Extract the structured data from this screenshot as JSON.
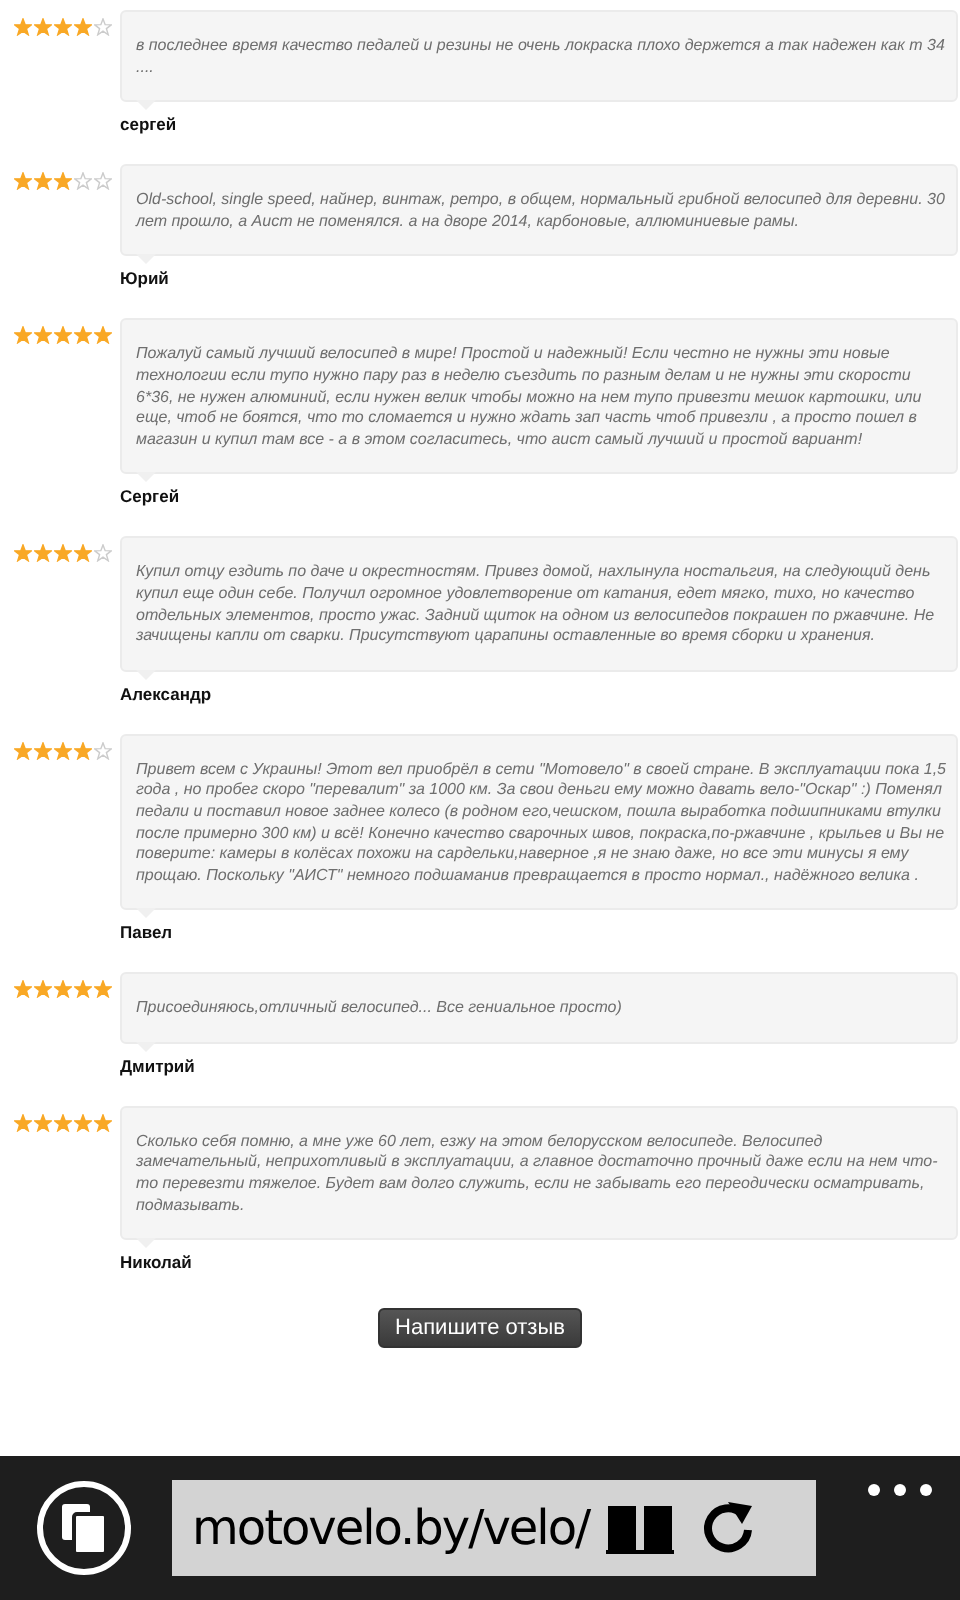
{
  "reviews": [
    {
      "stars": 4,
      "text": "в последнее время качество педалей и резины не очень локраска плохо держется а так надежен как т 34 ....",
      "author": "сергей"
    },
    {
      "stars": 3,
      "text": "Old-school, single speed, найнер, винтаж, ретро, в общем, нормальный грибной велосипед для деревни. 30 лет прошло, а Аист не поменялся. а на дворе 2014, карбоновые, аллюминиевые рамы.",
      "author": "Юрий"
    },
    {
      "stars": 5,
      "text": "Пожалуй самый лучший велосипед в мире! Простой и надежный! Если честно не нужны эти новые технологии если тупо нужно пару раз в неделю съездить по разным делам и не нужны эти скорости 6*36, не нужен алюминий, если нужен велик чтобы можно на нем тупо привезти мешок картошки, или еще, чтоб не боятся, что то сломается и нужно ждать зап часть чтоб привезли , а просто пошел в магазин и купил там все - а в этом согласитесь, что аист самый лучший и простой вариант!",
      "author": "Сергей"
    },
    {
      "stars": 4,
      "text": "Купил отцу ездить по даче и окрестностям. Привез домой, нахлынула ностальгия, на следующий день купил еще один себе. Получил огромное удовлетворение от катания, едет мягко, тихо, но качество отдельных элементов, просто ужас. Задний щиток на одном из велосипедов покрашен по ржавчине. Не зачищены капли от сварки. Присутствуют царапины оставленные во время сборки и хранения.",
      "author": "Александр"
    },
    {
      "stars": 4,
      "text": "Привет всем с Украины! Этот вел приобрёл в сети \"Мотовело\" в своей стране. В эксплуатации пока 1,5 года , но пробег скоро \"перевалит\" за 1000 км. За свои деньги ему можно давать вело-\"Оскар\" :) Поменял педали и поставил новое заднее колесо (в родном его,чешском, пошла выработка подшипниками втулки после примерно 300 км) и всё! Конечно качество сварочных швов, покраска,по-ржавчине , крыльев и Вы не поверите: камеры в колёсах похожи на сардельки,наверное ,я не знаю даже, но все эти минусы я ему прощаю. Поскольку \"АИСТ\" немного подшаманив превращается в просто нормал., надёжного велика .",
      "author": "Павел"
    },
    {
      "stars": 5,
      "text": "Присоединяюсь,отличный велосипед... Все гениальное просто)",
      "author": "Дмитрий"
    },
    {
      "stars": 5,
      "text": "Сколько себя помню, а мне уже 60 лет, езжу на этом белорусском велосипеде. Велосипед замечательный, неприхотливый в эксплуатации, а главное достаточно прочный даже если на нем что-то перевезти тяжелое. Будет вам долго служить, если не забывать его переодически осматривать, подмазывать.",
      "author": "Николай"
    }
  ],
  "write_button": "Напишите отзыв",
  "address_bar": {
    "url": "motovelo.by/velo/"
  }
}
